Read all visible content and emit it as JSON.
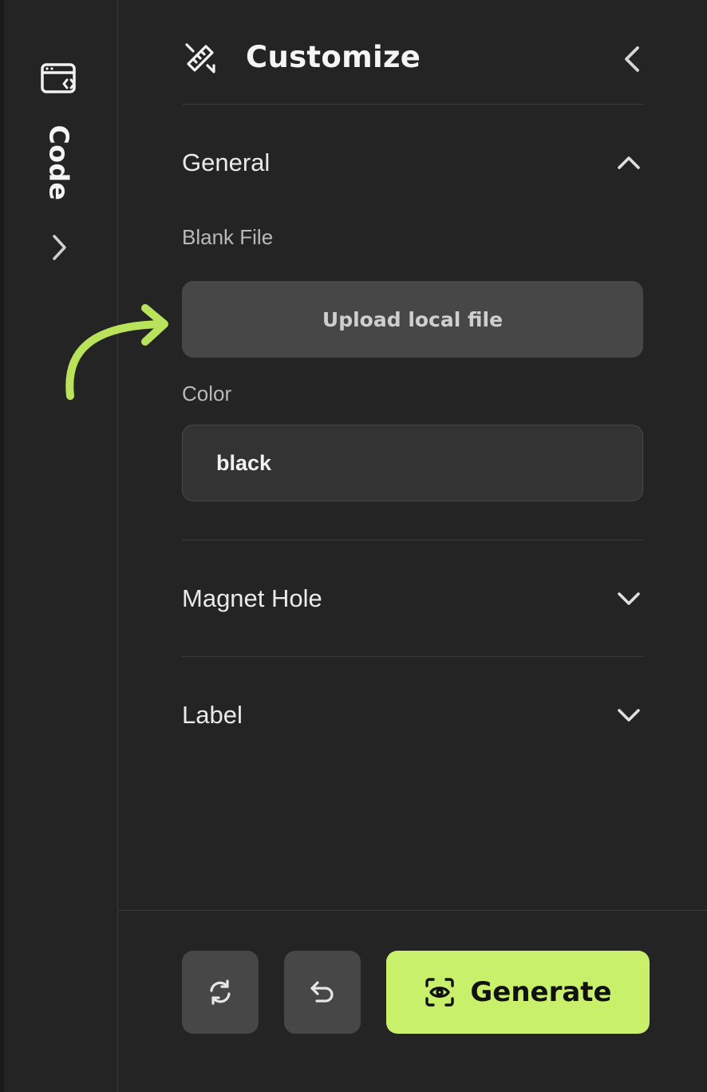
{
  "rail": {
    "label": "Code",
    "icon": "code-window-icon",
    "expand_icon": "chevron-right-icon"
  },
  "panel": {
    "title": "Customize",
    "header_icon": "ruler-pencil-icon",
    "collapse_icon": "chevron-left-icon",
    "sections": {
      "general": {
        "title": "General",
        "state": "expanded",
        "blank_file_label": "Blank File",
        "upload_label": "Upload local file",
        "color_label": "Color",
        "color_value": "black"
      },
      "magnet_hole": {
        "title": "Magnet Hole",
        "state": "collapsed"
      },
      "label": {
        "title": "Label",
        "state": "collapsed"
      }
    }
  },
  "footer": {
    "reset_icon": "refresh-icon",
    "undo_icon": "undo-icon",
    "generate_label": "Generate",
    "generate_icon": "eye-scan-icon"
  },
  "colors": {
    "background": "#242424",
    "accent": "#c8f06a",
    "annotation_arrow": "#b8e35a",
    "button_gray": "#474747"
  }
}
